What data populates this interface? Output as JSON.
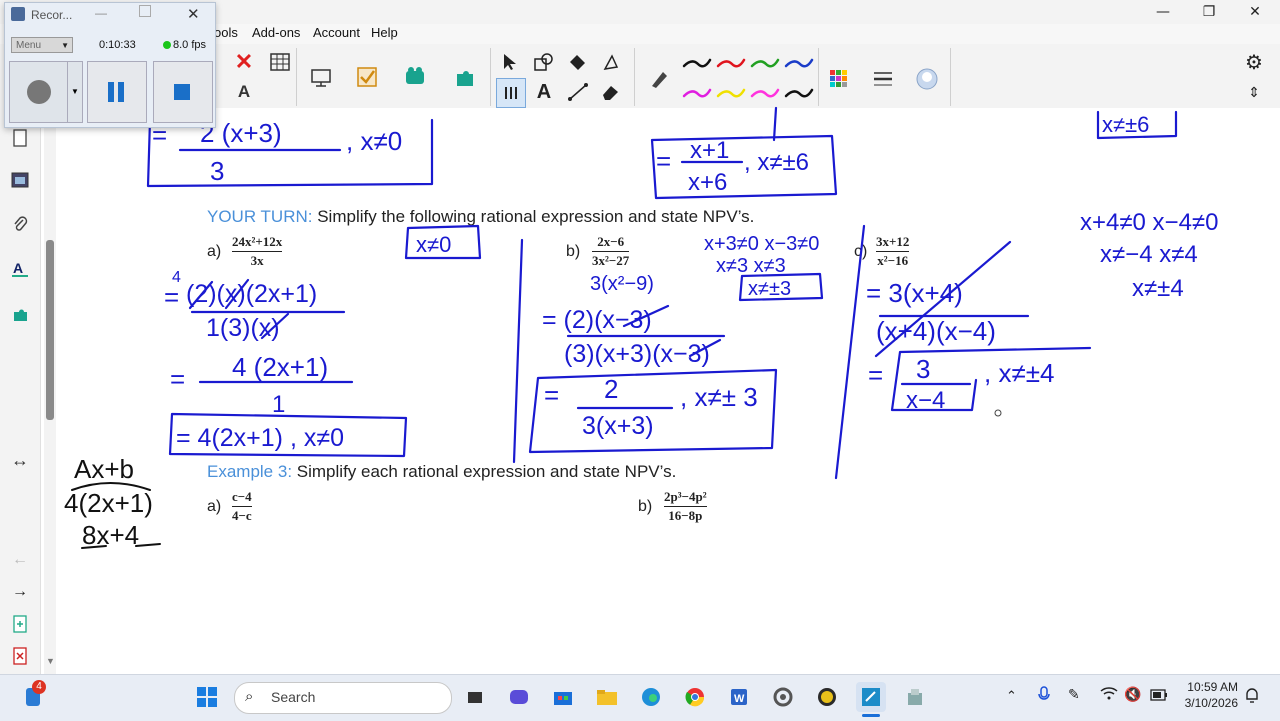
{
  "window": {
    "minimize_glyph": "—",
    "maximize_glyph": "❐",
    "close_glyph": "✕"
  },
  "menu": {
    "items": [
      "ools",
      "Add-ons",
      "Account",
      "Help"
    ]
  },
  "toolbar": {
    "icons": [
      "delete-icon",
      "table-icon",
      "text-recognize-icon",
      "screen-capture-icon",
      "check-icon",
      "puzzle-icon",
      "add-on-icon",
      "select-arrow-icon",
      "shapes-icon",
      "fill-icon",
      "eraser-icon",
      "text-icon",
      "line-icon",
      "highlighter-icon",
      "pen-icon",
      "color-palette-icon",
      "lines-icon",
      "cloud-icon"
    ],
    "pen_colors": [
      "#111111",
      "#e0141e",
      "#22a022",
      "#1a3cc8",
      "#e01ee0",
      "#f0e000",
      "#ff33dd",
      "#111111"
    ],
    "settings_icon": "gear-icon",
    "updown_icon": "updown-arrows-icon"
  },
  "recorder": {
    "title": "Recor...",
    "menu_label": "Menu",
    "time": "0:10:33",
    "fps": "8.0 fps",
    "minimize_glyph": "—",
    "close_glyph": "✕"
  },
  "document": {
    "your_turn_label": "YOUR TURN:",
    "your_turn_text": "Simplify the following rational expression and state NPV’s.",
    "example3_label": "Example 3:",
    "example3_text": "Simplify each rational expression and state NPV’s.",
    "problem_a_label": "a)",
    "problem_a_num": "24x²+12x",
    "problem_a_den": "3x",
    "problem_b_label": "b)",
    "problem_b_num": "2x−6",
    "problem_b_den": "3x²−27",
    "problem_c_label": "c)",
    "problem_c_num": "3x+12",
    "problem_c_den": "x²−16",
    "ex3_a_label": "a)",
    "ex3_a_num": "c−4",
    "ex3_a_den": "4−c",
    "ex3_b_label": "b)",
    "ex3_b_num": "2p³−4p²",
    "ex3_b_den": "16−8p"
  },
  "handwriting": {
    "top_left_num": "2 (x+3)",
    "top_left_den": "3",
    "top_left_npv": ", x≠0",
    "top_mid_num": "x+1",
    "top_mid_den": "x+6",
    "top_mid_npv": ", x≠±6",
    "top_right_box": "x≠±6",
    "a_box": "x≠0",
    "a_step1_num": "(2)(x)(2x+1)",
    "a_step1_den": "1(3)(x)",
    "a_step1_mark": "4",
    "a_step2_num": "4 (2x+1)",
    "a_step2_den": "1",
    "a_final": "= 4(2x+1) , x≠0",
    "b_factor": "3(x²−9)",
    "b_npv1": "x+3≠0   x−3≠0",
    "b_npv2": "x≠3     x≠3",
    "b_npv_box": "x≠±3",
    "b_step_num": "= (2)(x−3)",
    "b_step_den": "(3)(x+3)(x−3)",
    "b_final_num": "2",
    "b_final_den": "3(x+3)",
    "b_final_npv": ", x≠± 3",
    "c_step1": "= 3(x+4)",
    "c_step1_den": "(x+4)(x−4)",
    "c_final_num": "3",
    "c_final_den": "x−4",
    "c_final_npv": ", x≠±4",
    "c_npv1": "x+4≠0   x−4≠0",
    "c_npv2": "x≠−4    x≠4",
    "c_npv3": "x≠±4",
    "side_note1": "Ax+b",
    "side_note2": "4(2x+1)",
    "side_note3": "8x+4",
    "ink_color": "#1a1ad0"
  },
  "taskbar": {
    "search_placeholder": "Search",
    "time": "10:59 AM",
    "date": "3/10/2026",
    "notification_count": "4",
    "icons": [
      "windows-start-icon",
      "task-view-icon",
      "chat-icon",
      "store-icon",
      "file-explorer-icon",
      "edge-icon",
      "chrome-icon",
      "word-icon",
      "settings-icon",
      "app-icon",
      "whiteboard-icon",
      "app2-icon"
    ],
    "tray_icons": [
      "chevron-up-icon",
      "microphone-icon",
      "pen-icon",
      "wifi-icon",
      "volume-mute-icon",
      "battery-icon",
      "notification-icon"
    ]
  }
}
